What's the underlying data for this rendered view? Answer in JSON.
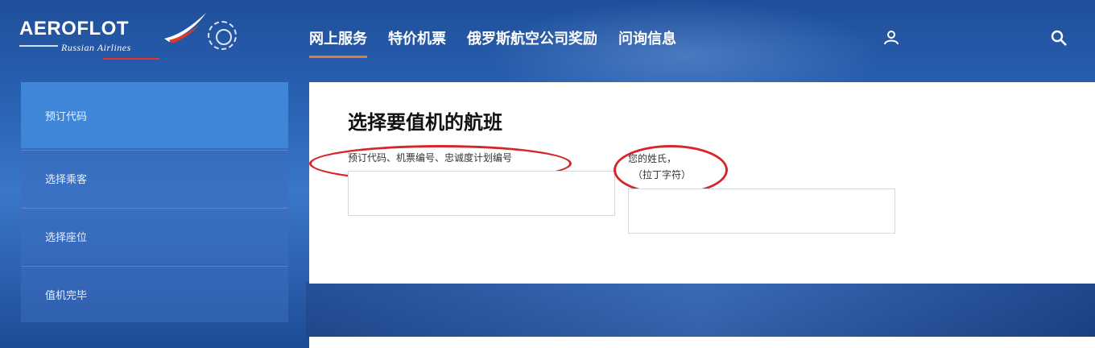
{
  "brand": {
    "name": "AEROFLOT",
    "subtitle": "Russian Airlines"
  },
  "nav": {
    "items": [
      {
        "label": "网上服务",
        "active": true
      },
      {
        "label": "特价机票",
        "active": false
      },
      {
        "label": "俄罗斯航空公司奖励",
        "active": false
      },
      {
        "label": "问询信息",
        "active": false
      }
    ],
    "icons": [
      "user-icon",
      "search-icon"
    ]
  },
  "sidebar": {
    "items": [
      {
        "label": "预订代码",
        "active": true
      },
      {
        "label": "选择乘客",
        "active": false
      },
      {
        "label": "选择座位",
        "active": false
      },
      {
        "label": "值机完毕",
        "active": false
      }
    ]
  },
  "form": {
    "title": "选择要值机的航班",
    "field1_label": "预订代码、机票编号、忠诚度计划编号",
    "field1_value": "",
    "field2_label_line1": "您的姓氏，",
    "field2_label_line2": "（拉丁字符）",
    "field2_value": ""
  },
  "colors": {
    "accent_underline": "#e07a3a",
    "annotation_red": "#d6262a",
    "sidebar_active": "#3f86d9"
  }
}
